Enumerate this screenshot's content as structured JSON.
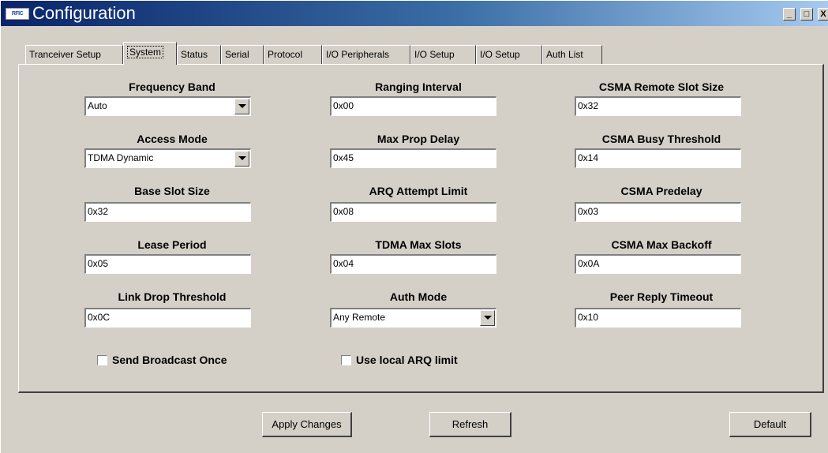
{
  "window": {
    "title": "Configuration",
    "icon_text": "RFIC",
    "controls": {
      "minimize": "_",
      "maximize": "□",
      "close": "X"
    }
  },
  "tabs": [
    {
      "label": "Tranceiver Setup",
      "active": false
    },
    {
      "label": "System",
      "active": true
    },
    {
      "label": "Status",
      "active": false
    },
    {
      "label": "Serial",
      "active": false
    },
    {
      "label": "Protocol",
      "active": false
    },
    {
      "label": "I/O Peripherals",
      "active": false
    },
    {
      "label": "I/O Setup",
      "active": false
    },
    {
      "label": "I/O Setup",
      "active": false
    },
    {
      "label": "Auth List",
      "active": false
    }
  ],
  "fields": {
    "frequency_band": {
      "label": "Frequency Band",
      "value": "Auto"
    },
    "access_mode": {
      "label": "Access Mode",
      "value": "TDMA Dynamic"
    },
    "base_slot_size": {
      "label": "Base Slot Size",
      "value": "0x32"
    },
    "lease_period": {
      "label": "Lease Period",
      "value": "0x05"
    },
    "link_drop_threshold": {
      "label": "Link Drop Threshold",
      "value": "0x0C"
    },
    "ranging_interval": {
      "label": "Ranging Interval",
      "value": "0x00"
    },
    "max_prop_delay": {
      "label": "Max Prop Delay",
      "value": "0x45"
    },
    "arq_attempt_limit": {
      "label": "ARQ Attempt Limit",
      "value": "0x08"
    },
    "tdma_max_slots": {
      "label": "TDMA Max Slots",
      "value": "0x04"
    },
    "auth_mode": {
      "label": "Auth Mode",
      "value": "Any Remote"
    },
    "csma_remote_slot_size": {
      "label": "CSMA Remote Slot Size",
      "value": "0x32"
    },
    "csma_busy_threshold": {
      "label": "CSMA Busy Threshold",
      "value": "0x14"
    },
    "csma_predelay": {
      "label": "CSMA Predelay",
      "value": "0x03"
    },
    "csma_max_backoff": {
      "label": "CSMA Max Backoff",
      "value": "0x0A"
    },
    "peer_reply_timeout": {
      "label": "Peer Reply Timeout",
      "value": "0x10"
    }
  },
  "checkboxes": {
    "send_broadcast_once": {
      "label": "Send Broadcast Once",
      "checked": false
    },
    "use_local_arq_limit": {
      "label": "Use local ARQ limit",
      "checked": false
    }
  },
  "buttons": {
    "apply": "Apply Changes",
    "refresh": "Refresh",
    "default": "Default"
  },
  "colors": {
    "face": "#d4d0c8",
    "titlebar_start": "#0a246a",
    "titlebar_end": "#a6caf0"
  }
}
